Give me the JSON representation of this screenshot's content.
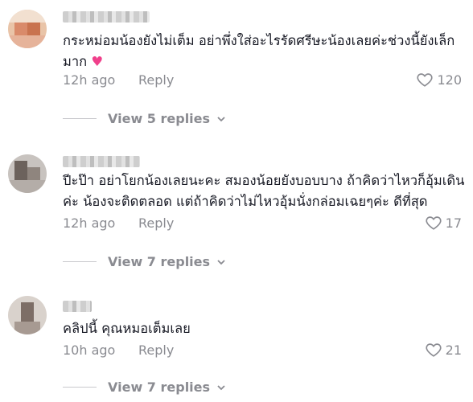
{
  "comments": [
    {
      "text": "กระหม่อมน้องยังไม่เต็ม อย่าพึ่งใส่อะไรรัดศรีษะน้องเลยค่ะช่วงนี้ยังเล็กมาก",
      "emoji": "♥",
      "time": "12h ago",
      "reply_label": "Reply",
      "likes": "120",
      "view_replies": "View 5 replies"
    },
    {
      "text": "ปีะป๊า อย่าโยกน้องเลยนะคะ สมองน้อยยังบอบบาง ถ้าคิดว่าไหวก็อุ้มเดินค่ะ น้องจะติดตลอด แต่ถ้าคิดว่าไม่ไหวอุ้มนั่งกล่อมเฉยๆค่ะ ดีที่สุด",
      "time": "12h ago",
      "reply_label": "Reply",
      "likes": "17",
      "view_replies": "View 7 replies"
    },
    {
      "text": "คลิปนี้ คุณหมอเต็มเลย",
      "time": "10h ago",
      "reply_label": "Reply",
      "likes": "21",
      "view_replies": "View 7 replies"
    }
  ],
  "icons": {
    "like": "heart-outline-icon",
    "expand": "chevron-down-icon"
  },
  "colors": {
    "text": "#161823",
    "muted": "#8a8b91",
    "emoji_heart": "#f0408b"
  }
}
